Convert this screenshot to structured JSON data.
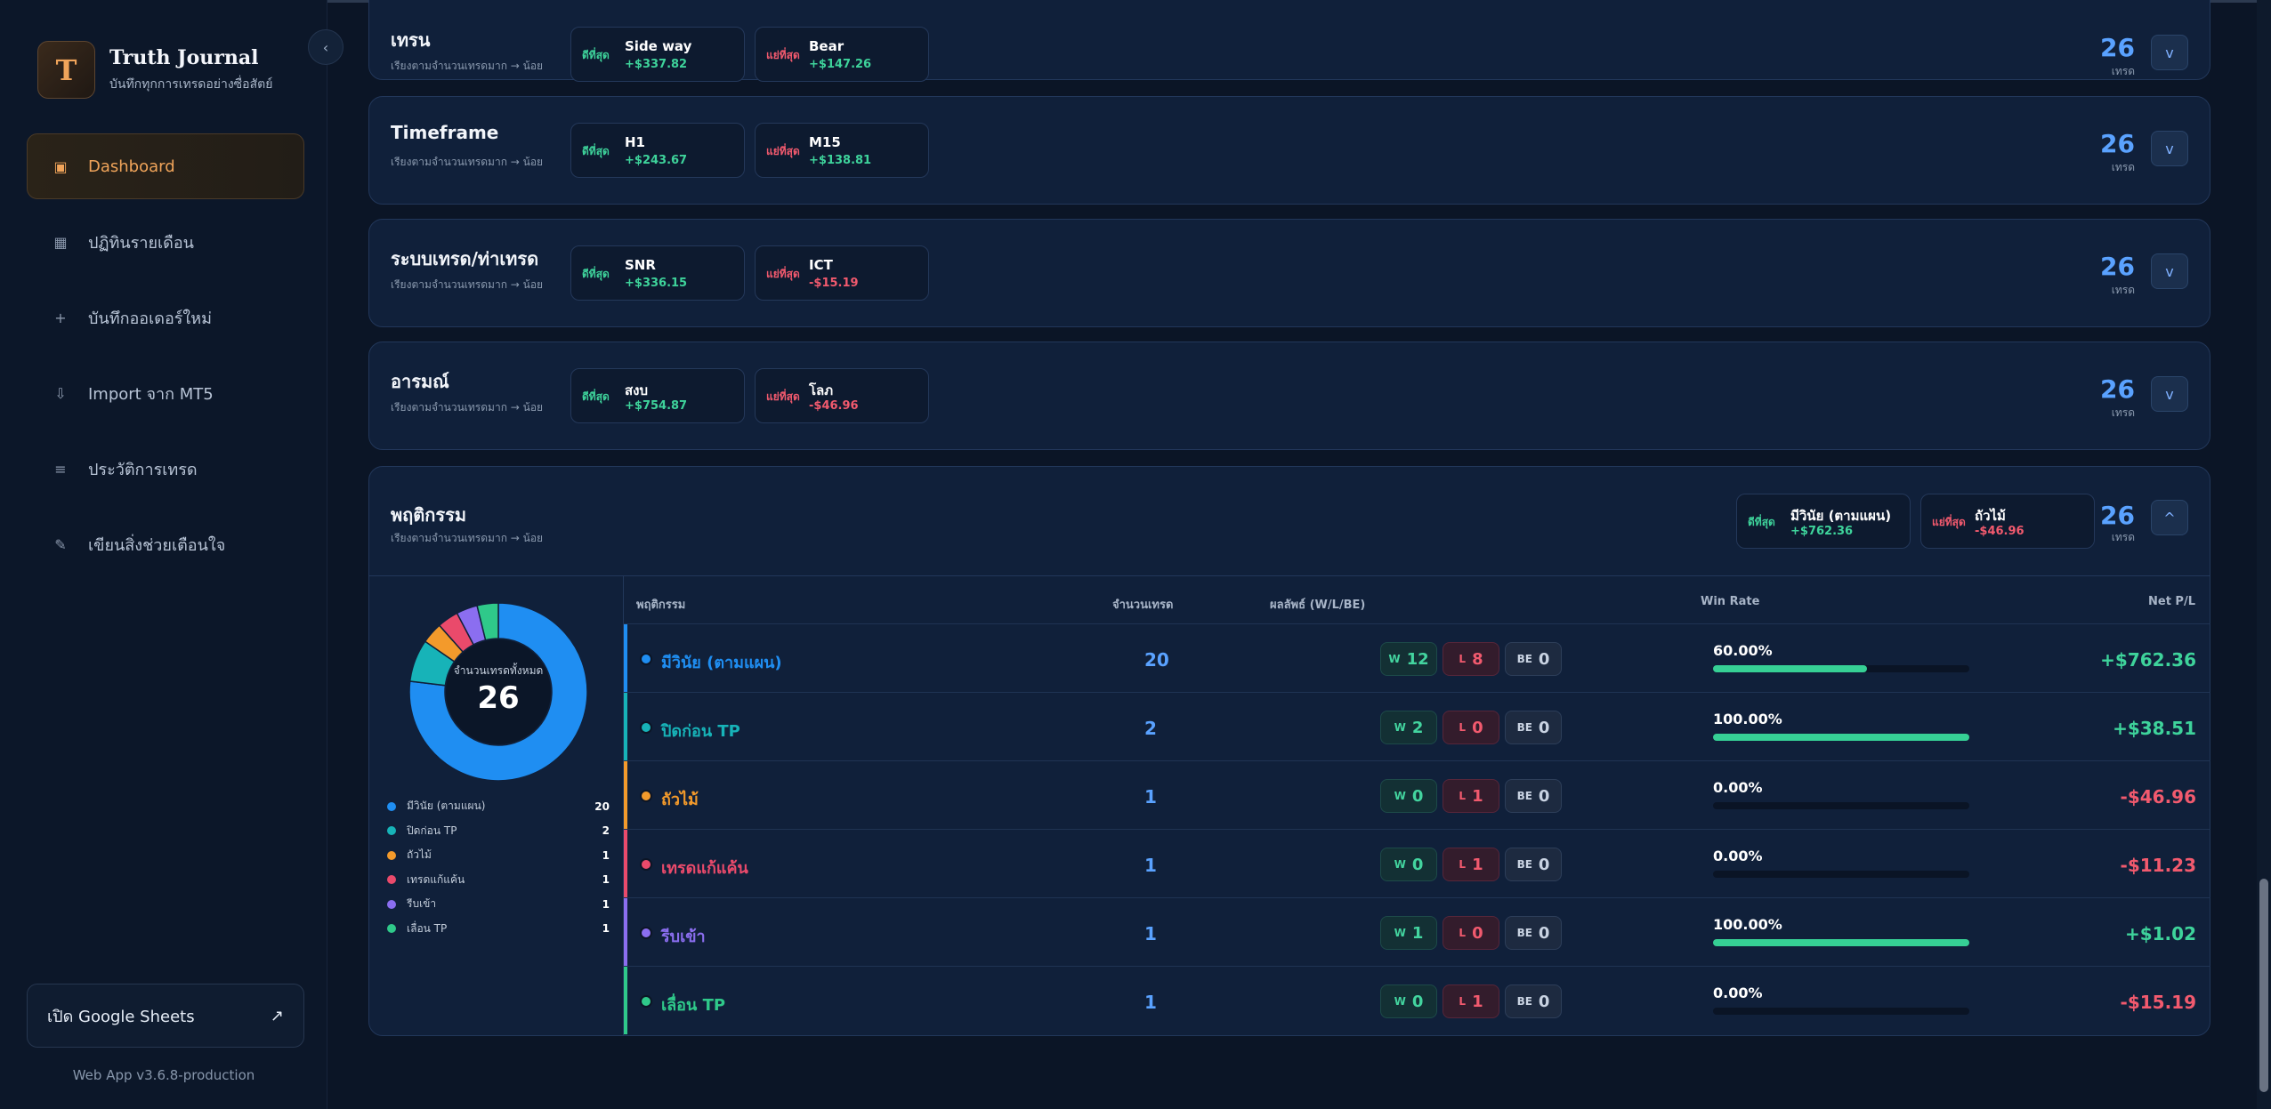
{
  "app": {
    "name": "Truth Journal",
    "tagline": "บันทึกทุกการเทรดอย่างซื่อสัตย์",
    "logo_letter": "T",
    "collapse_icon": "‹",
    "version": "Web App v3.6.8-production"
  },
  "nav": [
    {
      "label": "Dashboard",
      "icon": "▣",
      "icon_name": "dashboard-icon",
      "active": true
    },
    {
      "label": "ปฏิทินรายเดือน",
      "icon": "▦",
      "icon_name": "calendar-icon",
      "active": false
    },
    {
      "label": "บันทึกออเดอร์ใหม่",
      "icon": "+",
      "icon_name": "plus-icon",
      "active": false
    },
    {
      "label": "Import จาก MT5",
      "icon": "⇩",
      "icon_name": "import-icon",
      "active": false
    },
    {
      "label": "ประวัติการเทรด",
      "icon": "≡",
      "icon_name": "list-icon",
      "active": false
    },
    {
      "label": "เขียนสิ่งช่วยเตือนใจ",
      "icon": "✎",
      "icon_name": "pencil-icon",
      "active": false
    }
  ],
  "sheets_button": {
    "label": "เปิด Google Sheets",
    "icon": "↗"
  },
  "common": {
    "subtitle": "เรียงตามจำนวนเทรดมาก → น้อย",
    "best": "ดีที่สุด",
    "worst": "แย่ที่สุด",
    "unit": "เทรด",
    "collapsed_icon": "v",
    "expanded_icon": "^"
  },
  "cards": [
    {
      "title": "เทรน",
      "best_name": "Side way",
      "best_val": "+$337.82",
      "worst_name": "Bear",
      "worst_val": "+$147.26",
      "count": "26"
    },
    {
      "title": "Timeframe",
      "best_name": "H1",
      "best_val": "+$243.67",
      "worst_name": "M15",
      "worst_val": "+$138.81",
      "count": "26"
    },
    {
      "title": "ระบบเทรด/ท่าเทรด",
      "best_name": "SNR",
      "best_val": "+$336.15",
      "worst_name": "ICT",
      "worst_val": "-$15.19",
      "count": "26"
    },
    {
      "title": "อารมณ์",
      "best_name": "สงบ",
      "best_val": "+$754.87",
      "worst_name": "โลภ",
      "worst_val": "-$46.96",
      "count": "26"
    }
  ],
  "behavior": {
    "title": "พฤติกรรม",
    "best_name": "มีวินัย (ตามแผน)",
    "best_val": "+$762.36",
    "worst_name": "ถัวไม้",
    "worst_val": "-$46.96",
    "count": "26",
    "donut_label": "จำนวนเทรดทั้งหมด",
    "donut_total": "26",
    "headers": {
      "name": "พฤติกรรม",
      "count": "จำนวนเทรด",
      "result": "ผลลัพธ์ (W/L/BE)",
      "winrate": "Win Rate",
      "pl": "Net P/L"
    },
    "pill_labels": {
      "w": "W",
      "l": "L",
      "be": "BE"
    },
    "rows": [
      {
        "name": "มีวินัย (ตามแผน)",
        "color": "#1f8ef2",
        "count": 20,
        "w": "12",
        "l": "8",
        "be": "0",
        "winrate": "60.00%",
        "winrate_value": 60,
        "pl": "+$762.36",
        "pl_sign": "pos"
      },
      {
        "name": "ปิดก่อน TP",
        "color": "#17b3b8",
        "count": 2,
        "w": "2",
        "l": "0",
        "be": "0",
        "winrate": "100.00%",
        "winrate_value": 100,
        "pl": "+$38.51",
        "pl_sign": "pos"
      },
      {
        "name": "ถัวไม้",
        "color": "#f39a2b",
        "count": 1,
        "w": "0",
        "l": "1",
        "be": "0",
        "winrate": "0.00%",
        "winrate_value": 0,
        "pl": "-$46.96",
        "pl_sign": "neg"
      },
      {
        "name": "เทรดแก้แค้น",
        "color": "#ea4a6b",
        "count": 1,
        "w": "0",
        "l": "1",
        "be": "0",
        "winrate": "0.00%",
        "winrate_value": 0,
        "pl": "-$11.23",
        "pl_sign": "neg"
      },
      {
        "name": "รีบเข้า",
        "color": "#8b6ef0",
        "count": 1,
        "w": "1",
        "l": "0",
        "be": "0",
        "winrate": "100.00%",
        "winrate_value": 100,
        "pl": "+$1.02",
        "pl_sign": "pos"
      },
      {
        "name": "เลื่อน TP",
        "color": "#2fc98a",
        "count": 1,
        "w": "0",
        "l": "1",
        "be": "0",
        "winrate": "0.00%",
        "winrate_value": 0,
        "pl": "-$15.19",
        "pl_sign": "neg"
      }
    ]
  }
}
